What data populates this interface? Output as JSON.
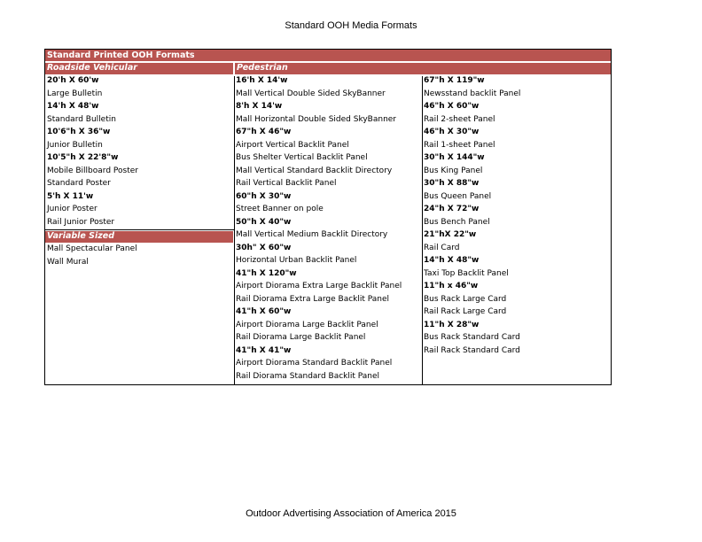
{
  "title": "Standard OOH Media Formats",
  "footer": "Outdoor Advertising Association of America 2015",
  "table": {
    "main_header": "Standard Printed OOH Formats",
    "roadside": {
      "header": "Roadside Vehicular",
      "rows": [
        {
          "t": "20'h X 60'w",
          "b": true
        },
        {
          "t": "Large Bulletin",
          "b": false
        },
        {
          "t": "14'h X 48'w",
          "b": true
        },
        {
          "t": "Standard Bulletin",
          "b": false
        },
        {
          "t": "10'6\"h X 36\"w",
          "b": true
        },
        {
          "t": "Junior Bulletin",
          "b": false
        },
        {
          "t": "10'5\"h X 22'8\"w",
          "b": true
        },
        {
          "t": "Mobile Billboard Poster",
          "b": false
        },
        {
          "t": "Standard Poster",
          "b": false
        },
        {
          "t": "5'h X 11'w",
          "b": true
        },
        {
          "t": "Junior Poster",
          "b": false
        },
        {
          "t": "Rail Junior Poster",
          "b": false
        }
      ]
    },
    "variable": {
      "header": "Variable Sized",
      "rows": [
        {
          "t": "Mall Spectacular Panel",
          "b": false
        },
        {
          "t": "Wall Mural",
          "b": false
        }
      ]
    },
    "pedestrian": {
      "header": "Pedestrian",
      "col1": [
        {
          "t": "16'h X 14'w",
          "b": true
        },
        {
          "t": "Mall Vertical Double Sided SkyBanner",
          "b": false
        },
        {
          "t": "8'h X 14'w",
          "b": true
        },
        {
          "t": "Mall Horizontal Double Sided SkyBanner",
          "b": false
        },
        {
          "t": "67\"h X 46\"w",
          "b": true
        },
        {
          "t": "Airport Vertical Backlit Panel",
          "b": false
        },
        {
          "t": "Bus Shelter Vertical Backlit Panel",
          "b": false
        },
        {
          "t": "Mall Vertical Standard Backlit Directory",
          "b": false
        },
        {
          "t": "Rail Vertical Backlit Panel",
          "b": false
        },
        {
          "t": "60\"h X 30\"w",
          "b": true
        },
        {
          "t": "Street Banner on pole",
          "b": false
        },
        {
          "t": "50\"h X 40\"w",
          "b": true
        },
        {
          "t": "Mall Vertical Medium Backlit Directory",
          "b": false
        },
        {
          "t": "30h\" X 60\"w",
          "b": true
        },
        {
          "t": "Horizontal Urban Backlit Panel",
          "b": false
        },
        {
          "t": "41\"h X 120\"w",
          "b": true
        },
        {
          "t": "Airport Diorama Extra Large Backlit Panel",
          "b": false
        },
        {
          "t": "Rail Diorama Extra Large Backlit Panel",
          "b": false
        },
        {
          "t": "41\"h X 60\"w",
          "b": true
        },
        {
          "t": "Airport Diorama Large Backlit Panel",
          "b": false
        },
        {
          "t": "Rail Diorama Large Backlit Panel",
          "b": false
        },
        {
          "t": "41\"h X 41\"w",
          "b": true
        },
        {
          "t": "Airport Diorama Standard Backlit Panel",
          "b": false
        },
        {
          "t": "Rail Diorama Standard Backlit Panel",
          "b": false
        }
      ],
      "col2": [
        {
          "t": "67\"h X 119\"w",
          "b": true
        },
        {
          "t": "Newsstand backlit Panel",
          "b": false
        },
        {
          "t": "46\"h X 60\"w",
          "b": true
        },
        {
          "t": "Rail 2-sheet Panel",
          "b": false
        },
        {
          "t": "46\"h X 30\"w",
          "b": true
        },
        {
          "t": "Rail 1-sheet Panel",
          "b": false
        },
        {
          "t": "30\"h X 144\"w",
          "b": true
        },
        {
          "t": "Bus King Panel",
          "b": false
        },
        {
          "t": "30\"h X 88\"w",
          "b": true
        },
        {
          "t": "Bus Queen Panel",
          "b": false
        },
        {
          "t": "24\"h X 72\"w",
          "b": true
        },
        {
          "t": "Bus Bench Panel",
          "b": false
        },
        {
          "t": "21\"hX 22\"w",
          "b": true
        },
        {
          "t": "Rail Card",
          "b": false
        },
        {
          "t": "14\"h X 48\"w",
          "b": true
        },
        {
          "t": "Taxi Top Backlit Panel",
          "b": false
        },
        {
          "t": "11\"h x 46\"w",
          "b": true
        },
        {
          "t": "Bus Rack Large Card",
          "b": false
        },
        {
          "t": "Rail Rack Large Card",
          "b": false
        },
        {
          "t": "11\"h X 28\"w",
          "b": true
        },
        {
          "t": "Bus Rack Standard Card",
          "b": false
        },
        {
          "t": "Rail Rack Standard Card",
          "b": false
        }
      ]
    }
  }
}
